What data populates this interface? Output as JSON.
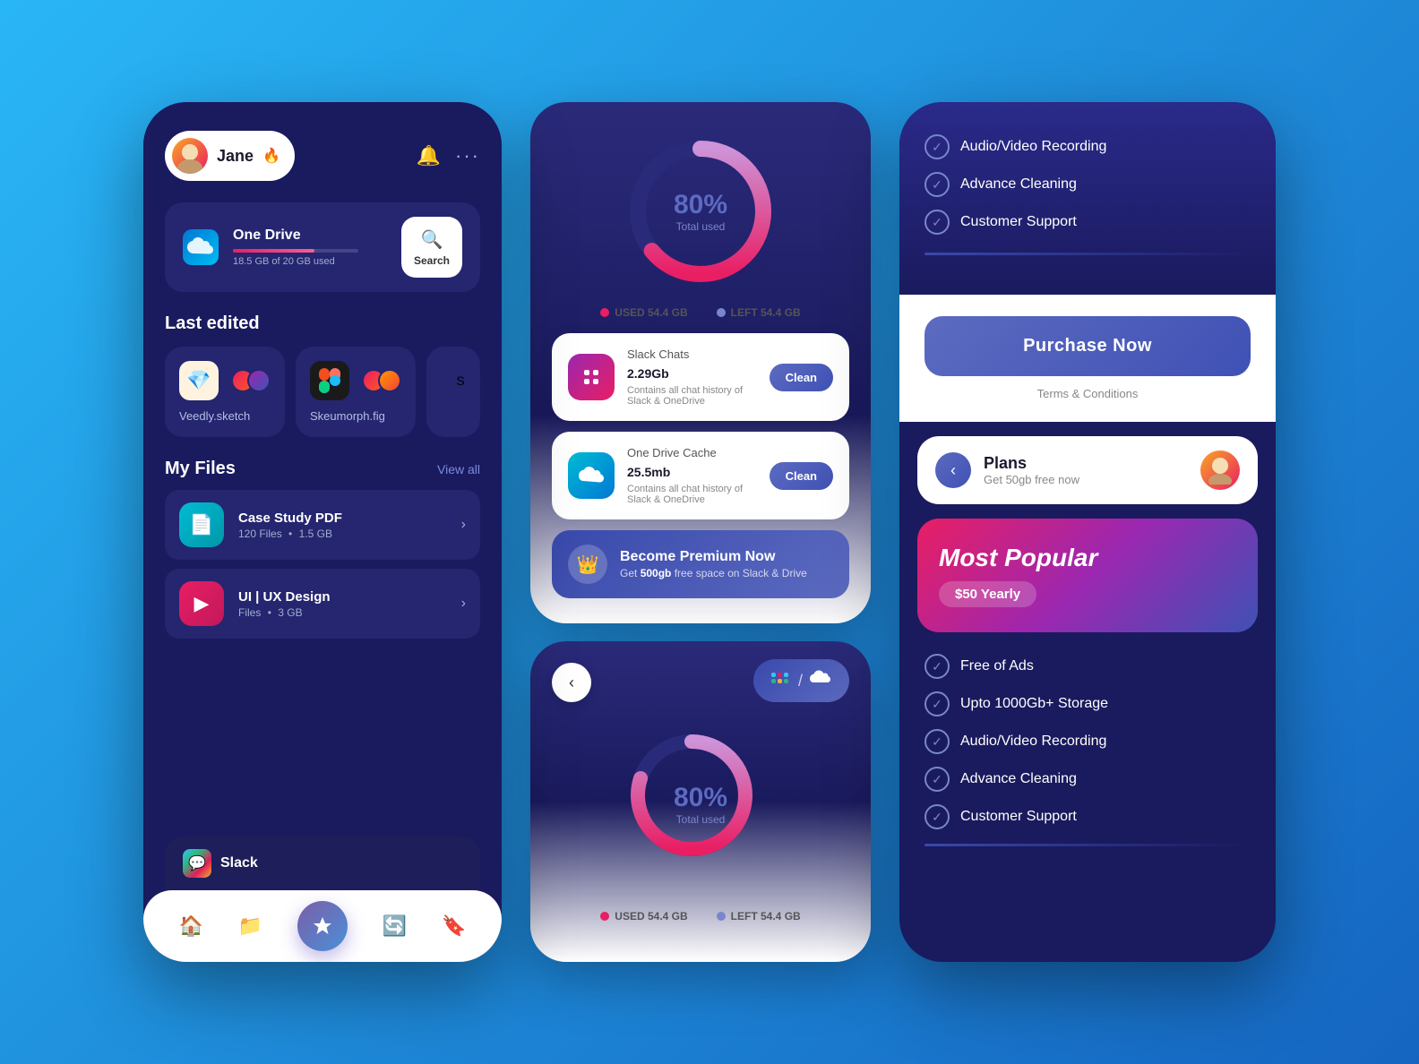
{
  "panel1": {
    "user": {
      "name": "Jane",
      "emoji": "🔥"
    },
    "storage": {
      "service": "One Drive",
      "used_text": "18.5 GB of 20 GB used",
      "bar_percent": 65,
      "logo_emoji": "☁️"
    },
    "search_label": "Search",
    "last_edited_title": "Last edited",
    "files": [
      {
        "name": "Veedly.sketch",
        "icon": "💎",
        "icon_bg": "sketch"
      },
      {
        "name": "Skeumorph.fig",
        "icon": "🎨",
        "icon_bg": "figma"
      }
    ],
    "my_files_title": "My Files",
    "view_all": "View all",
    "file_list": [
      {
        "name": "Case Study PDF",
        "meta": "120 Files",
        "size": "1.5 GB",
        "color": "fli-blue",
        "icon": "📄"
      },
      {
        "name": "UI | UX Design",
        "meta": "Files",
        "size": "3 GB",
        "color": "fli-pink",
        "icon": "▶"
      }
    ],
    "toast": {
      "icon": "💬",
      "label": "Slack"
    },
    "nav_icons": [
      "🏠",
      "📁",
      "👑",
      "🔄",
      "🔖"
    ]
  },
  "panel2": {
    "top_card": {
      "donut_percent": "80%",
      "donut_label": "Total used",
      "used_label": "USED 54.4 GB",
      "left_label": "LEFT 54.4 GB"
    },
    "items": [
      {
        "name": "Slack Chats",
        "size": "2.29",
        "unit": "Gb",
        "desc": "Contains all chat history of Slack & OneDrive",
        "icon": "💬",
        "icon_class": "purple",
        "clean_label": "Clean"
      },
      {
        "name": "One Drive Cache",
        "size": "25.5",
        "unit": "mb",
        "desc": "Contains all chat history of Slack & OneDrive",
        "icon": "☁️",
        "icon_class": "blue2",
        "clean_label": "Clean"
      }
    ],
    "premium": {
      "icon": "👑",
      "title": "Become Premium Now",
      "desc": "Get ",
      "highlight": "500gb",
      "desc2": " free space on Slack & Drive"
    },
    "bottom_card": {
      "donut_percent": "80%",
      "donut_label": "Total used",
      "used_label": "USED 54.4 GB",
      "left_label": "LEFT 54.4 GB"
    }
  },
  "panel3": {
    "top_features": [
      "Audio/Video Recording",
      "Advance Cleaning",
      "Customer Support"
    ],
    "purchase_btn": "Purchase Now",
    "terms": "Terms & Conditions",
    "plans_section": {
      "back_icon": "‹",
      "title": "Plans",
      "subtitle": "Get 50gb free now"
    },
    "popular": {
      "title": "Most Popular",
      "price": "$50 Yearly"
    },
    "bottom_features": [
      "Free of Ads",
      "Upto 1000Gb+ Storage",
      "Audio/Video Recording",
      "Advance Cleaning",
      "Customer Support"
    ]
  }
}
